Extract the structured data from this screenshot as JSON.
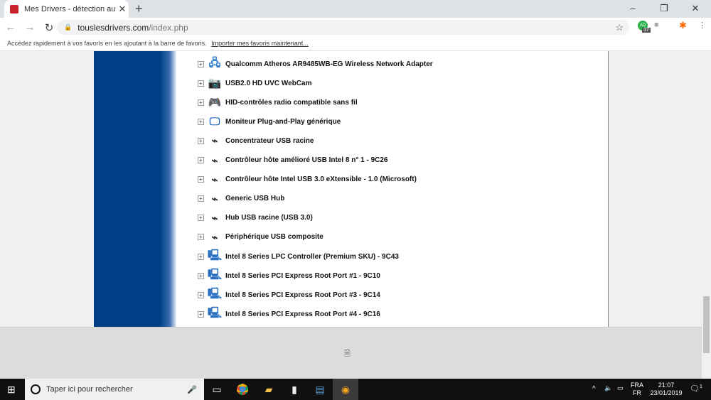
{
  "browser": {
    "tab_title": "Mes Drivers - détection automati",
    "url_host": "touslesdrivers.com",
    "url_path": "/index.php",
    "ext_badge": "37",
    "ext_initials": "AD",
    "bookmarks_hint": "Accédez rapidement à vos favoris en les ajoutant à la barre de favoris.",
    "bookmarks_link": "Importer mes favoris maintenant..."
  },
  "devices": [
    {
      "name": "Qualcomm Atheros AR9485WB-EG Wireless Network Adapter",
      "icon": "network-icon"
    },
    {
      "name": "USB2.0 HD UVC WebCam",
      "icon": "webcam-icon"
    },
    {
      "name": "HID-contrôles radio compatible sans fil",
      "icon": "gamepad-icon"
    },
    {
      "name": "Moniteur Plug-and-Play générique",
      "icon": "monitor-icon"
    },
    {
      "name": "Concentrateur USB racine",
      "icon": "usb-icon"
    },
    {
      "name": "Contrôleur hôte amélioré USB Intel 8 n° 1 - 9C26",
      "icon": "usb-icon"
    },
    {
      "name": "Contrôleur hôte Intel USB 3.0 eXtensible - 1.0 (Microsoft)",
      "icon": "usb-icon"
    },
    {
      "name": "Generic USB Hub",
      "icon": "usb-icon"
    },
    {
      "name": "Hub USB racine (USB 3.0)",
      "icon": "usb-icon"
    },
    {
      "name": "Périphérique USB composite",
      "icon": "usb-icon"
    },
    {
      "name": "Intel 8 Series LPC Controller (Premium SKU) - 9C43",
      "icon": "system-icon"
    },
    {
      "name": "Intel 8 Series PCI Express Root Port #1 - 9C10",
      "icon": "system-icon"
    },
    {
      "name": "Intel 8 Series PCI Express Root Port #3 - 9C14",
      "icon": "system-icon"
    },
    {
      "name": "Intel 8 Series PCI Express Root Port #4 - 9C16",
      "icon": "system-icon"
    }
  ],
  "taskbar": {
    "search_placeholder": "Taper ici pour rechercher",
    "lang1": "FRA",
    "lang2": "FR",
    "time": "21:07",
    "date": "23/01/2019",
    "notif_count": "1"
  }
}
